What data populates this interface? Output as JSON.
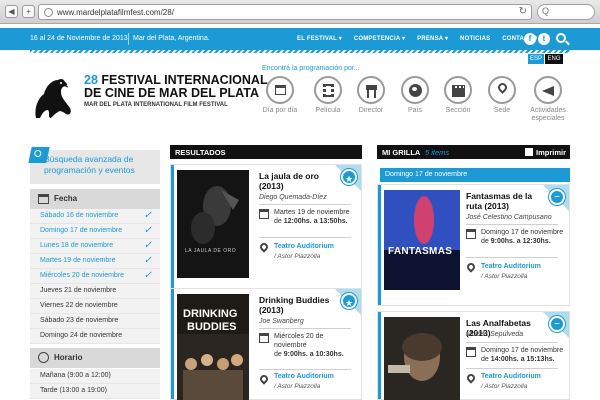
{
  "browser": {
    "url": "www.mardelplatafilmfest.com/28/",
    "back_glyph": "◀",
    "add_glyph": "+",
    "reload_glyph": "↻",
    "search_glyph": "Q"
  },
  "topbar": {
    "dates": "16 al 24 de Noviembre de 2013",
    "location": "Mar del Plata, Argentina.",
    "menu": [
      "EL FESTIVAL ▾",
      "COMPETENCIA ▾",
      "PRENSA ▾",
      "NOTICIAS",
      "CONTACTO"
    ],
    "social": [
      "f",
      "t"
    ]
  },
  "lang": {
    "esp": "ESP",
    "eng": "ENG"
  },
  "logo": {
    "number": "28",
    "line1": " FESTIVAL INTERNACIONAL",
    "line2": "DE CINE DE MAR DEL PLATA",
    "sub": "MAR DEL PLATA INTERNATIONAL FILM FESTIVAL"
  },
  "programacion": {
    "label": "Encontrá la programación por...",
    "categories": [
      {
        "label": "Día por día",
        "icon": "calendar-icon"
      },
      {
        "label": "Película",
        "icon": "film-icon"
      },
      {
        "label": "Director",
        "icon": "director-chair-icon"
      },
      {
        "label": "País",
        "icon": "globe-icon"
      },
      {
        "label": "Sección",
        "icon": "clapperboard-icon"
      },
      {
        "label": "Sede",
        "icon": "location-pin-icon"
      },
      {
        "label": "Actividades especiales",
        "icon": "megaphone-icon"
      }
    ]
  },
  "sidebar": {
    "title": "Búsqueda avanzada de programación y eventos",
    "fecha_label": "Fecha",
    "days": [
      {
        "label": "Sábado 16 de noviembre",
        "checked": true
      },
      {
        "label": "Domingo 17 de noviembre",
        "checked": true
      },
      {
        "label": "Lunes 18 de noviembre",
        "checked": true
      },
      {
        "label": "Martes 19 de noviembre",
        "checked": true
      },
      {
        "label": "Miércoles 20 de noviembre",
        "checked": true
      },
      {
        "label": "Jueves 21 de noviembre",
        "checked": false
      },
      {
        "label": "Viernes 22 de noviembre",
        "checked": false
      },
      {
        "label": "Sábado 23 de noviembre",
        "checked": false
      },
      {
        "label": "Domingo 24 de noviembre",
        "checked": false
      }
    ],
    "horario_label": "Horario",
    "horarios": [
      "Mañana (9:00 a 12:00)",
      "Tarde (13:00 a 19:00)"
    ],
    "check_glyph": "✓"
  },
  "results": {
    "header": "RESULTADOS",
    "items": [
      {
        "title_line1": "La jaula de oro",
        "title_line2": "(2013)",
        "director": "Diego Quemada-Díez",
        "date": "Martes 19 de noviembre",
        "time_prefix": "de ",
        "time": "12:00hs. a 13:50hs.",
        "venue": "Teatro Auditorium",
        "room": "/ Astor Piazzolla",
        "poster_text": "LA JAULA DE ORO"
      },
      {
        "title_line1": "Drinking Buddies",
        "title_line2": "(2013)",
        "director": "Joe Swanberg",
        "date_line1": "Miércoles 20 de",
        "date_line2": "noviembre",
        "time_prefix": "de ",
        "time": "9:00hs. a 10:30hs.",
        "venue": "Teatro Auditorium",
        "room": "/ Astor Piazzolla",
        "poster_text_1": "DRINKING",
        "poster_text_2": "BUDDIES"
      }
    ],
    "star_glyph": "★"
  },
  "grilla": {
    "header": "MI GRILLA",
    "count": "5 items",
    "print_label": "Imprimir",
    "day": "Domingo 17 de noviembre",
    "items": [
      {
        "title_line1": "Fantasmas de la",
        "title_line2": "ruta (2013)",
        "director": "José Celestino Campusano",
        "date_line1": "Domingo 17 de noviembre",
        "time_prefix": "de ",
        "time": "9:00hs. a 12:30hs.",
        "venue": "Teatro Auditorium",
        "room": "/ Astor Piazzolla",
        "poster_text": "FANTASMAS"
      },
      {
        "title_line1": "Las Analfabetas",
        "title_line2": "(2013)",
        "director": "Moisés Sepúlveda",
        "date_line1": "Domingo 17 de noviembre",
        "time_prefix": "de ",
        "time": "14:00hs. a 15:13hs.",
        "venue": "Teatro Auditorium",
        "room": "/ Astor Piazzolla"
      }
    ],
    "minus_glyph": "−"
  },
  "colors": {
    "accent": "#1c9ad6",
    "dark": "#111111",
    "sidebar": "#e7e7e7"
  }
}
